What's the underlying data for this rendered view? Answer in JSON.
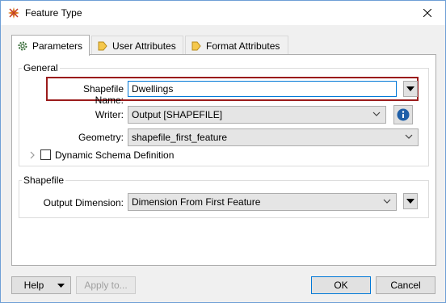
{
  "window": {
    "title": "Feature Type",
    "app_icon": "fme-workbench-icon"
  },
  "tabs": [
    {
      "label": "Parameters",
      "icon": "gear-icon",
      "active": true
    },
    {
      "label": "User Attributes",
      "icon": "arrow-tag-icon",
      "active": false
    },
    {
      "label": "Format Attributes",
      "icon": "arrow-tag-icon",
      "active": false
    }
  ],
  "general": {
    "title": "General",
    "shapefile_name": {
      "label": "Shapefile Name:",
      "value": "Dwellings"
    },
    "writer": {
      "label": "Writer:",
      "value": "Output [SHAPEFILE]"
    },
    "geometry": {
      "label": "Geometry:",
      "value": "shapefile_first_feature"
    },
    "dynamic_schema": {
      "label": "Dynamic Schema Definition",
      "checked": false
    }
  },
  "shapefile": {
    "title": "Shapefile",
    "output_dimension": {
      "label": "Output Dimension:",
      "value": "Dimension From First Feature"
    }
  },
  "footer": {
    "help": "Help",
    "apply": "Apply to...",
    "ok": "OK",
    "cancel": "Cancel"
  },
  "colors": {
    "highlight": "#9b1c1c",
    "info": "#1f5fa8",
    "window_border": "#6e9fd6"
  }
}
